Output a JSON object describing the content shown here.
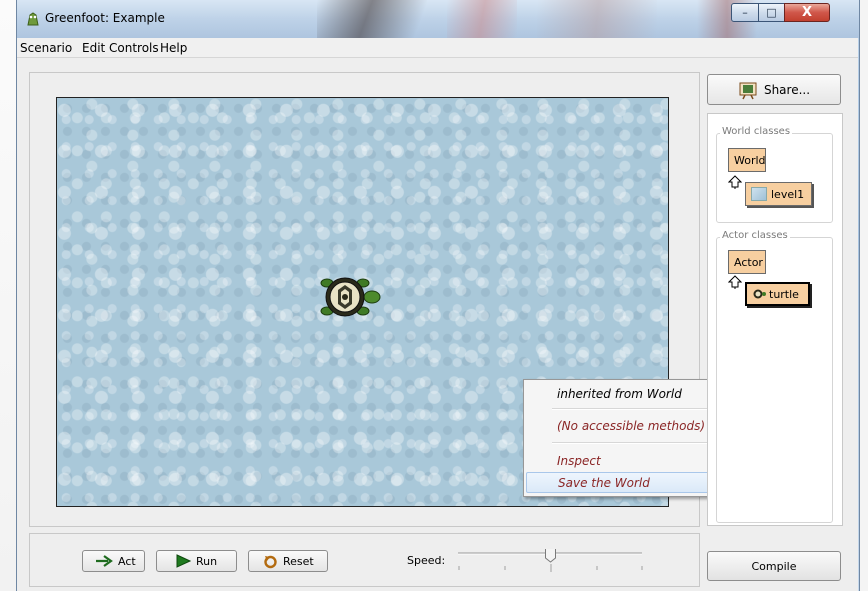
{
  "window": {
    "title": "Greenfoot: Example",
    "controls": {
      "minimize": "–",
      "maximize": "□",
      "close": "X"
    }
  },
  "menubar": [
    "Scenario",
    "Edit",
    "Controls",
    "Help"
  ],
  "toolbar": {
    "share_label": "Share...",
    "compile_label": "Compile"
  },
  "class_browser": {
    "world_group_title": "World classes",
    "world_class": "World",
    "world_subclass": "level1",
    "actor_group_title": "Actor classes",
    "actor_class": "Actor",
    "actor_subclass": "turtle"
  },
  "context_menu": {
    "items": [
      "inherited from World",
      "(No accessible methods)",
      "Inspect",
      "Save the World"
    ],
    "highlighted": "Save the World"
  },
  "controls": {
    "act_label": "Act",
    "run_label": "Run",
    "reset_label": "Reset",
    "speed_label": "Speed:",
    "speed_fraction": 0.5
  },
  "colors": {
    "class_box": "#f7cfa0",
    "world_background": "#a9c8d9",
    "method_text": "#8a2525"
  },
  "icons": [
    "greenfoot-icon",
    "share-icon",
    "act-icon",
    "run-icon",
    "reset-icon",
    "inherit-arrow-icon",
    "turtle-icon"
  ]
}
